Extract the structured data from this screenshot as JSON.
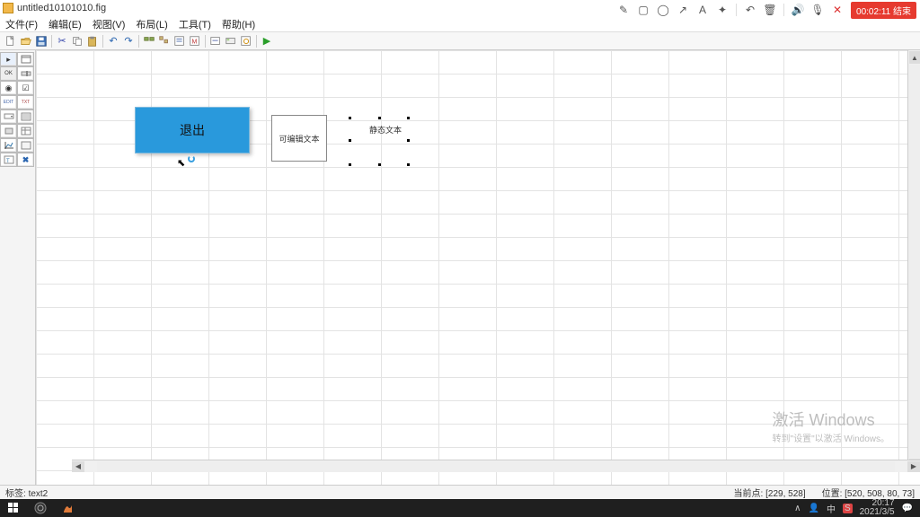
{
  "window": {
    "title": "untitled10101010.fig"
  },
  "menu": {
    "file": "文件(F)",
    "edit": "编辑(E)",
    "view": "视图(V)",
    "layout": "布局(L)",
    "tools": "工具(T)",
    "help": "帮助(H)"
  },
  "topright": {
    "rec": "00:02:11 结束"
  },
  "canvas": {
    "button_exit": "退出",
    "edit_text": "可编辑文本",
    "static_text": "静态文本"
  },
  "status": {
    "left_label": "标签:",
    "left_value": "text2",
    "current_point_label": "当前点:",
    "current_point": "[229, 528]",
    "position_label": "位置:",
    "position": "[520, 508, 80, 73]"
  },
  "watermark": {
    "l1": "激活 Windows",
    "l2": "转到\"设置\"以激活 Windows。"
  },
  "taskbar": {
    "time": "20:17",
    "date": "2021/3/5",
    "tray": {
      "up": "∧",
      "net": "ᯤ",
      "sound": "🔈",
      "ime": "中",
      "s": "S"
    }
  },
  "palette_glyphs": [
    [
      "▸",
      "▦"
    ],
    [
      "OK",
      "☑"
    ],
    [
      "◉",
      "▯"
    ],
    [
      "TXT",
      "TXT"
    ],
    [
      "▭",
      "▭"
    ],
    [
      "≣",
      "☰"
    ],
    [
      "⊞",
      "T"
    ],
    [
      "📈",
      "▦"
    ],
    [
      "🎚",
      "✖"
    ]
  ],
  "toolbar_icons": [
    "new",
    "open",
    "save",
    "|",
    "cut",
    "copy",
    "paste",
    "|",
    "undo",
    "redo",
    "|",
    "a",
    "b",
    "c",
    "d",
    "|",
    "e",
    "f",
    "g",
    "|",
    "run"
  ]
}
